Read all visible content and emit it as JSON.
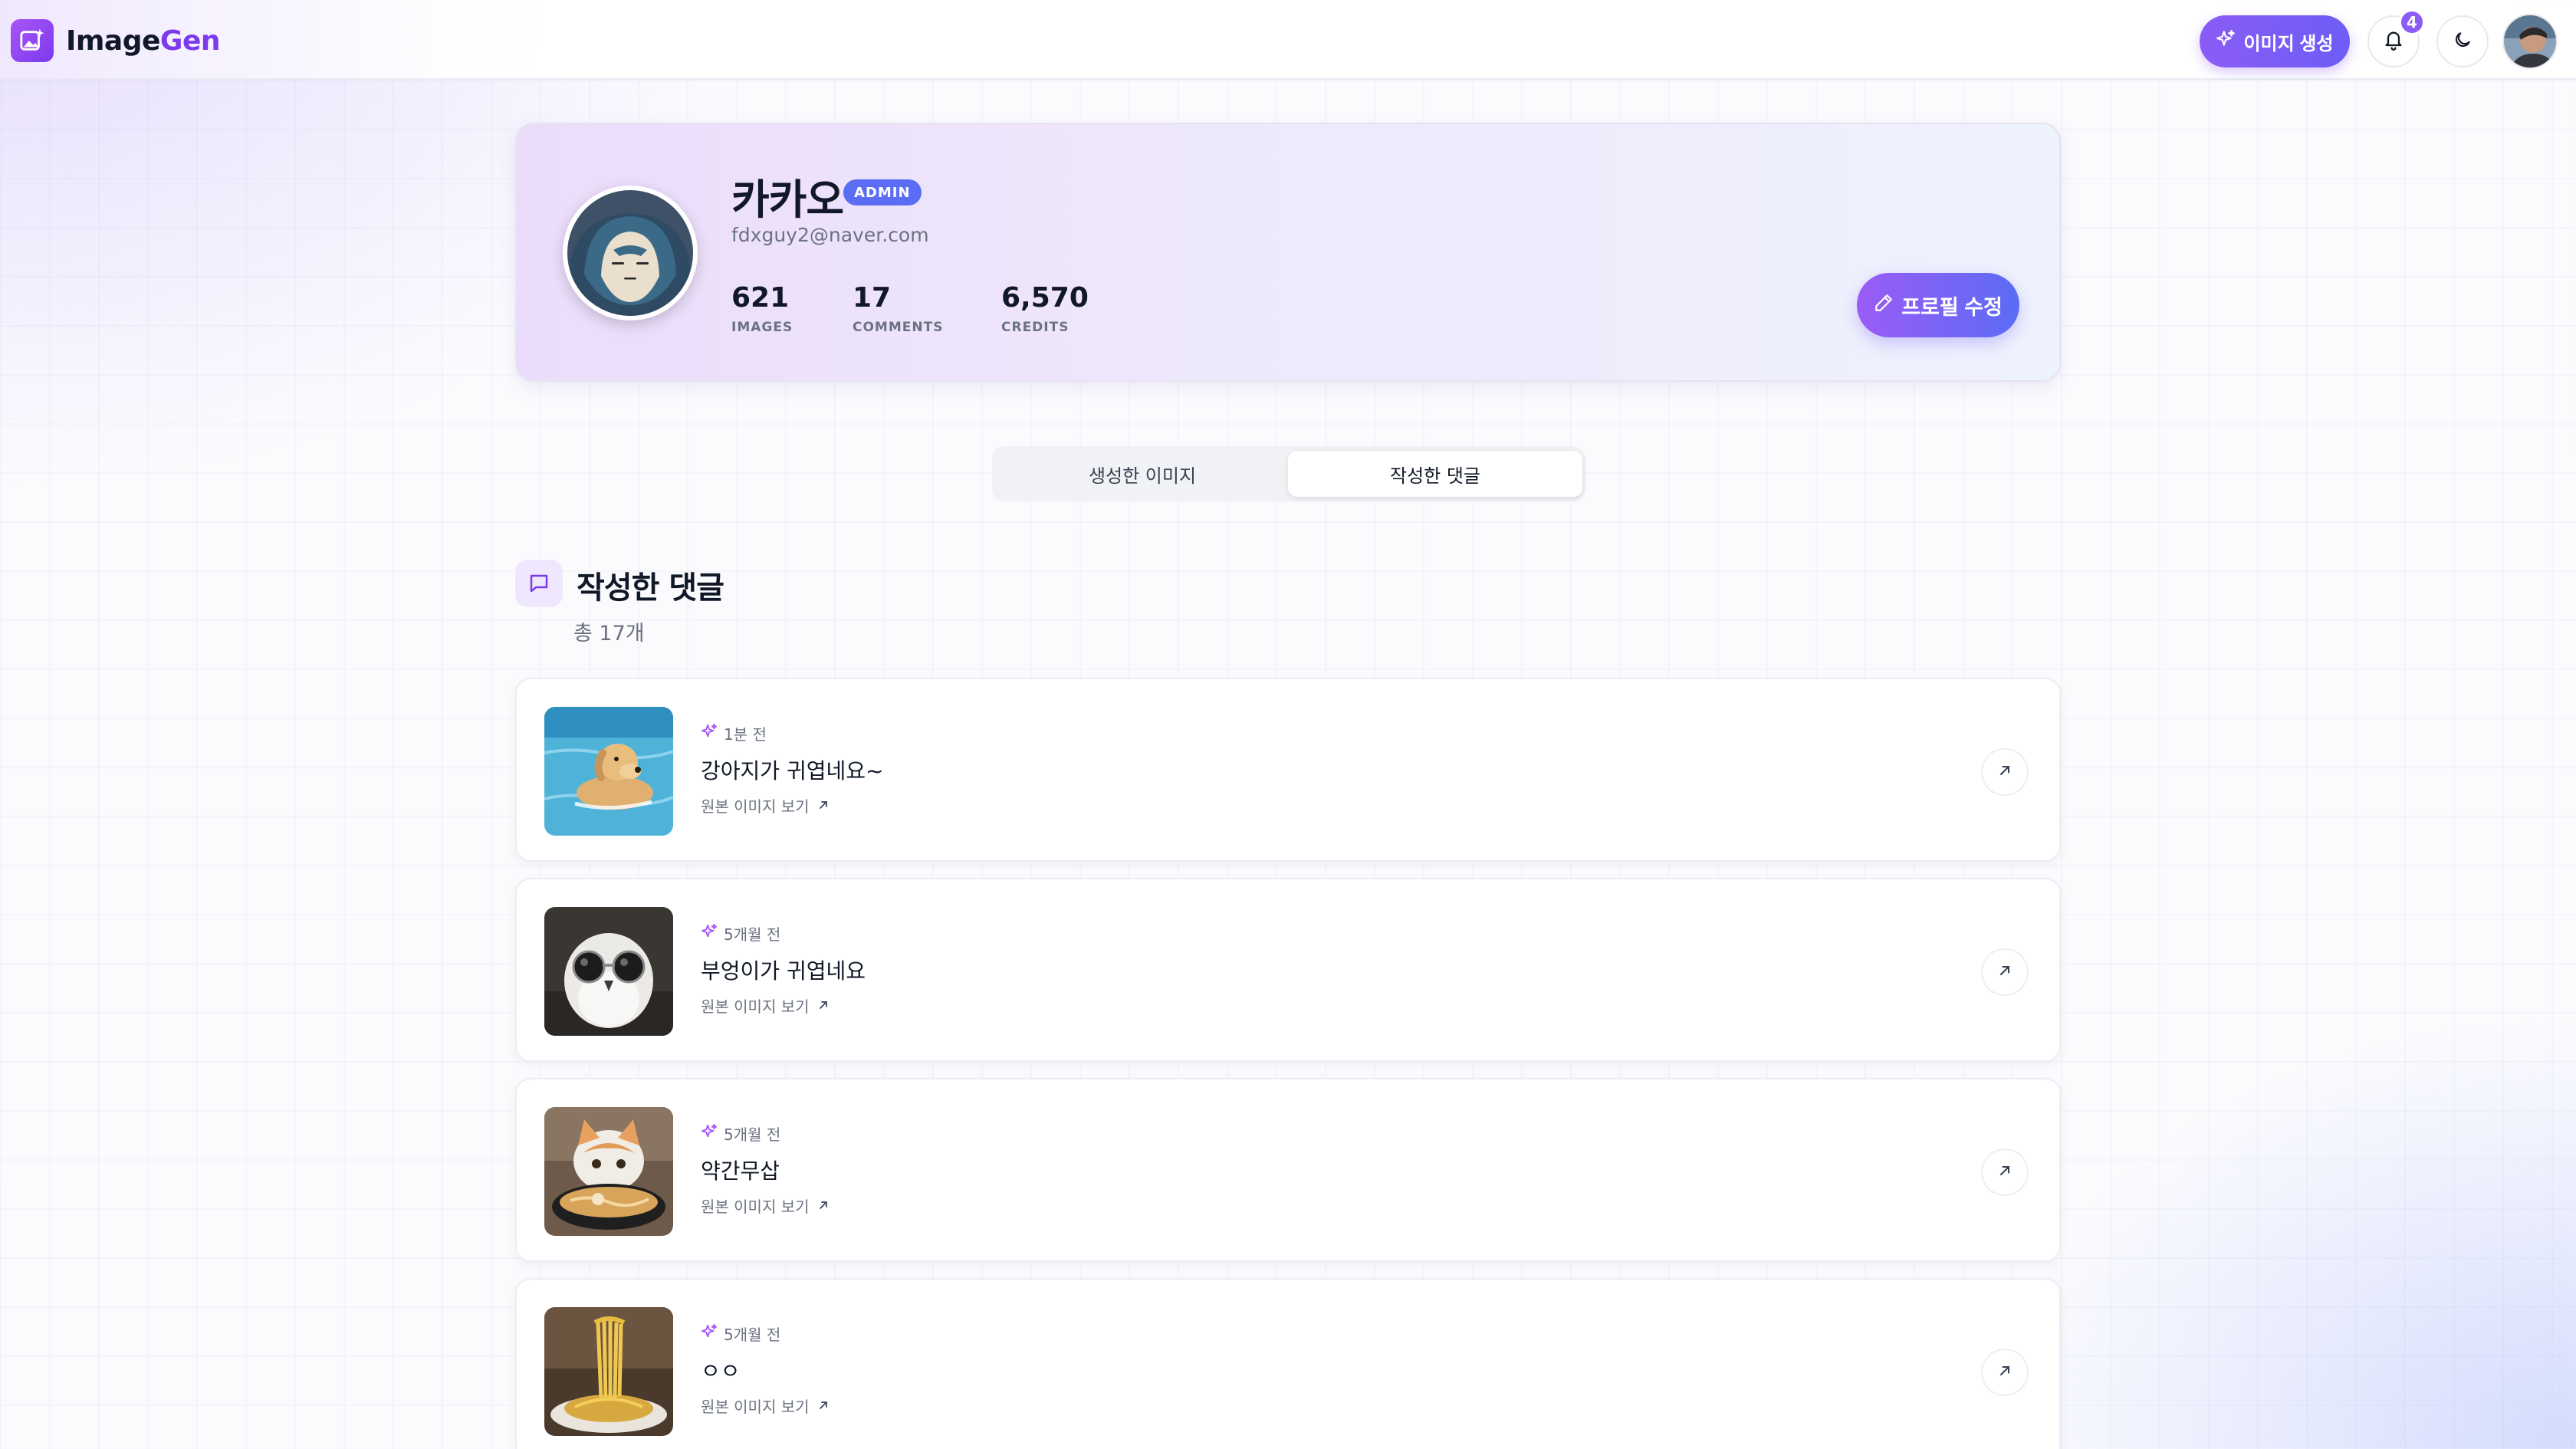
{
  "app": {
    "logo_part1": "Image",
    "logo_part2": "Gen"
  },
  "header": {
    "generate_label": "이미지 생성",
    "notification_count": "4"
  },
  "profile": {
    "name": "카카오",
    "role_badge": "ADMIN",
    "email": "fdxguy2@naver.com",
    "stats": [
      {
        "value": "621",
        "label": "IMAGES"
      },
      {
        "value": "17",
        "label": "COMMENTS"
      },
      {
        "value": "6,570",
        "label": "CREDITS"
      }
    ],
    "edit_label": "프로필 수정"
  },
  "tabs": [
    {
      "label": "생성한 이미지",
      "active": false
    },
    {
      "label": "작성한 댓글",
      "active": true
    }
  ],
  "section": {
    "title": "작성한 댓글",
    "count": "총 17개"
  },
  "comments": [
    {
      "time": "1분 전",
      "text": "강아지가 귀엽네요~",
      "link_label": "원본 이미지 보기",
      "thumb": "dog-swimming"
    },
    {
      "time": "5개월 전",
      "text": "부엉이가 귀엽네요",
      "link_label": "원본 이미지 보기",
      "thumb": "owl-sunglasses"
    },
    {
      "time": "5개월 전",
      "text": "약간무삽",
      "link_label": "원본 이미지 보기",
      "thumb": "cat-ramen"
    },
    {
      "time": "5개월 전",
      "text": "ㅇㅇ",
      "link_label": "원본 이미지 보기",
      "thumb": "spaghetti"
    }
  ],
  "colors": {
    "accent": "#8b5cf6",
    "accent_blue": "#5b6cf5",
    "text": "#111827",
    "muted": "#6b7280"
  }
}
